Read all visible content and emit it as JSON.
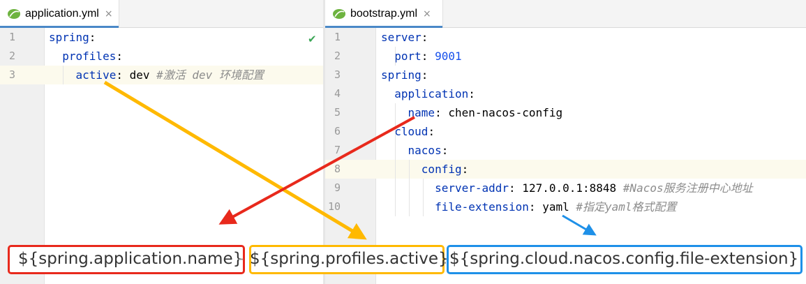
{
  "left_editor": {
    "tab": {
      "filename": "application.yml",
      "close": "×"
    },
    "lines": [
      {
        "num": "1",
        "indent": "",
        "key": "spring",
        "colon": ":",
        "value": "",
        "comment": ""
      },
      {
        "num": "2",
        "indent": "  ",
        "key": "profiles",
        "colon": ":",
        "value": "",
        "comment": ""
      },
      {
        "num": "3",
        "indent": "    ",
        "key": "active",
        "colon": ":",
        "value": " dev ",
        "comment": "#激活 dev 环境配置"
      }
    ],
    "status_icon": "checkmark-icon"
  },
  "right_editor": {
    "tab": {
      "filename": "bootstrap.yml",
      "close": "×"
    },
    "lines": [
      {
        "num": "1",
        "indent": "",
        "key": "server",
        "colon": ":",
        "value": "",
        "comment": ""
      },
      {
        "num": "2",
        "indent": "  ",
        "key": "port",
        "colon": ": ",
        "value": "9001",
        "comment": ""
      },
      {
        "num": "3",
        "indent": "",
        "key": "spring",
        "colon": ":",
        "value": "",
        "comment": ""
      },
      {
        "num": "4",
        "indent": "  ",
        "key": "application",
        "colon": ":",
        "value": "",
        "comment": ""
      },
      {
        "num": "5",
        "indent": "    ",
        "key": "name",
        "colon": ":",
        "value": " chen-nacos-config",
        "comment": ""
      },
      {
        "num": "6",
        "indent": "  ",
        "key": "cloud",
        "colon": ":",
        "value": "",
        "comment": ""
      },
      {
        "num": "7",
        "indent": "    ",
        "key": "nacos",
        "colon": ":",
        "value": "",
        "comment": ""
      },
      {
        "num": "8",
        "indent": "      ",
        "key": "config",
        "colon": ":",
        "value": "",
        "comment": ""
      },
      {
        "num": "9",
        "indent": "        ",
        "key": "server-addr",
        "colon": ":",
        "value": " 127.0.0.1:8848 ",
        "comment": "#Nacos服务注册中心地址"
      },
      {
        "num": "10",
        "indent": "        ",
        "key": "file-extension",
        "colon": ":",
        "value": " yaml ",
        "comment": "#指定yaml格式配置"
      }
    ]
  },
  "annotations": {
    "app_name": "${spring.application.name}",
    "separator": "-",
    "profile": "${spring.profiles.active}",
    "separator2": ".",
    "extension": "${spring.cloud.nacos.config.file-extension}",
    "colors": {
      "red": "#e8291c",
      "orange": "#ffb900",
      "blue": "#1e90e8"
    }
  },
  "colors": {
    "keyword": "#0033b3",
    "number": "#1750eb",
    "comment": "#8c8c8c",
    "highlight_line": "#fcfaed"
  }
}
